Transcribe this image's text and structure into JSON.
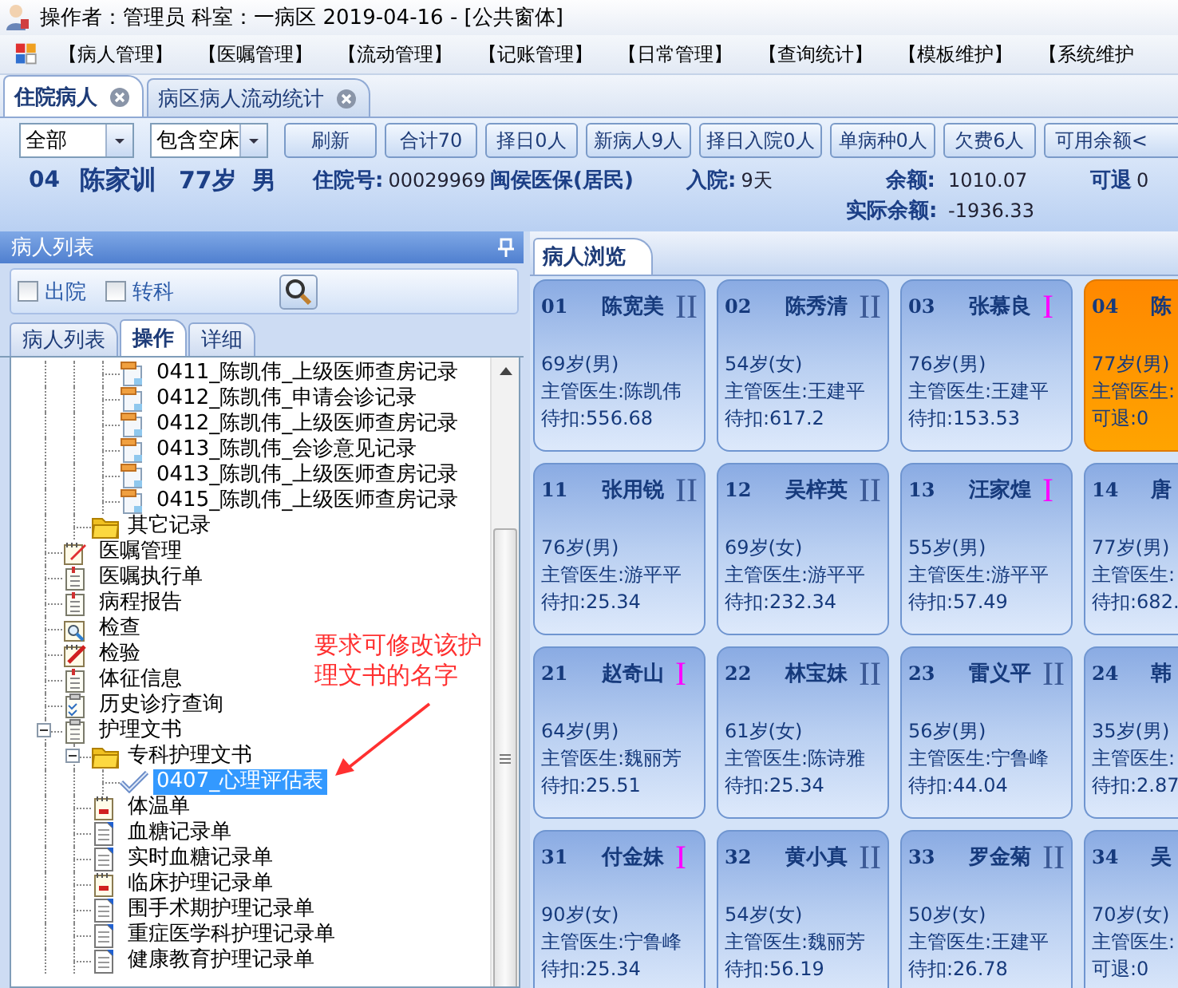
{
  "title_bar": {
    "text": "操作者：管理员 科室：一病区 2019-04-16 - [公共窗体]"
  },
  "menu": [
    "【病人管理】",
    "【医嘱管理】",
    "【流动管理】",
    "【记账管理】",
    "【日常管理】",
    "【查询统计】",
    "【模板维护】",
    "【系统维护"
  ],
  "doc_tabs": [
    {
      "label": "住院病人",
      "selected": true
    },
    {
      "label": "病区病人流动统计",
      "selected": false
    }
  ],
  "toolbar": {
    "selects": [
      "全部",
      "包含空床"
    ],
    "buttons": [
      "刷新",
      "合计70",
      "择日0人",
      "新病人9人",
      "择日入院0人",
      "单病种0人",
      "欠费6人",
      "可用余额<"
    ]
  },
  "patient_info": {
    "bed": "04",
    "name": "陈家训",
    "age": "77岁",
    "sex": "男",
    "admission_no": {
      "label": "住院号:",
      "value": "00029969"
    },
    "insurance": "闽侯医保(居民)",
    "admitted": {
      "label": "入院:",
      "value": "9天"
    },
    "balance": {
      "label": "余额:",
      "value": "1010.07"
    },
    "refundable": {
      "label": "可退",
      "value": "0"
    },
    "actual_balance": {
      "label": "实际余额:",
      "value": "-1936.33"
    }
  },
  "sidebar": {
    "title": "病人列表",
    "filters": [
      {
        "label": "出院",
        "checked": false
      },
      {
        "label": "转科",
        "checked": false
      }
    ],
    "tabs": [
      {
        "label": "病人列表",
        "selected": false
      },
      {
        "label": "操作",
        "selected": true
      },
      {
        "label": "详细",
        "selected": false
      }
    ],
    "tree": [
      {
        "children": [
          {
            "children": [
              {
                "kind": "record",
                "label": "0411_陈凯伟_上级医师查房记录",
                "selected": false
              },
              {
                "kind": "record",
                "label": "0412_陈凯伟_申请会诊记录",
                "selected": false
              },
              {
                "kind": "record",
                "label": "0412_陈凯伟_上级医师查房记录",
                "selected": false
              },
              {
                "kind": "record",
                "label": "0413_陈凯伟_会诊意见记录",
                "selected": false
              },
              {
                "kind": "record",
                "label": "0413_陈凯伟_上级医师查房记录",
                "selected": false
              },
              {
                "kind": "record",
                "label": "0415_陈凯伟_上级医师查房记录",
                "selected": false
              }
            ]
          },
          {
            "kind": "folder",
            "label": "其它记录",
            "selected": false
          }
        ]
      },
      {
        "kind": "order",
        "label": "医嘱管理",
        "selected": false
      },
      {
        "kind": "sheet",
        "label": "医嘱执行单",
        "selected": false
      },
      {
        "kind": "sheet",
        "label": "病程报告",
        "selected": false
      },
      {
        "kind": "exam",
        "label": "检查",
        "selected": false
      },
      {
        "kind": "lab",
        "label": "检验",
        "selected": false
      },
      {
        "kind": "sheet",
        "label": "体征信息",
        "selected": false
      },
      {
        "kind": "checklist",
        "label": "历史诊疗查询",
        "selected": false
      },
      {
        "kind": "clipboard",
        "label": "护理文书",
        "selected": false,
        "expanded": true,
        "children": [
          {
            "kind": "folder",
            "label": "专科护理文书",
            "selected": false,
            "expanded": true,
            "children": [
              {
                "kind": "check",
                "label": "0407_心理评估表",
                "selected": true
              }
            ]
          },
          {
            "kind": "chart",
            "label": "体温单",
            "selected": false
          },
          {
            "kind": "page",
            "label": "血糖记录单",
            "selected": false
          },
          {
            "kind": "page",
            "label": "实时血糖记录单",
            "selected": false
          },
          {
            "kind": "chart",
            "label": "临床护理记录单",
            "selected": false
          },
          {
            "kind": "page",
            "label": "围手术期护理记录单",
            "selected": false
          },
          {
            "kind": "page",
            "label": "重症医学科护理记录单",
            "selected": false
          },
          {
            "kind": "page",
            "label": "健康教育护理记录单",
            "selected": false
          }
        ]
      }
    ],
    "annotation": "要求可修改该护理文书的名字"
  },
  "browser": {
    "tab": "病人浏览",
    "patients": [
      {
        "bed": "01",
        "name": "陈宽美",
        "grade": "II",
        "color": "#3c5a96",
        "age": "69岁(男)",
        "doctor": "主管医生:陈凯伟",
        "balance": "待扣:556.68",
        "selected": false
      },
      {
        "bed": "02",
        "name": "陈秀清",
        "grade": "II",
        "color": "#3c5a96",
        "age": "54岁(女)",
        "doctor": "主管医生:王建平",
        "balance": "待扣:617.2",
        "selected": false
      },
      {
        "bed": "03",
        "name": "张慕良",
        "grade": "I",
        "color": "#ff00ff",
        "age": "76岁(男)",
        "doctor": "主管医生:王建平",
        "balance": "待扣:153.53",
        "selected": false
      },
      {
        "bed": "04",
        "name": "陈",
        "age": "77岁(男)",
        "doctor": "主管医生:",
        "balance": "可退:0",
        "selected": true
      },
      {
        "bed": "11",
        "name": "张用锐",
        "grade": "II",
        "color": "#3c5a96",
        "age": "76岁(男)",
        "doctor": "主管医生:游平平",
        "balance": "待扣:25.34",
        "selected": false
      },
      {
        "bed": "12",
        "name": "吴梓英",
        "grade": "II",
        "color": "#3c5a96",
        "age": "69岁(女)",
        "doctor": "主管医生:游平平",
        "balance": "待扣:232.34",
        "selected": false
      },
      {
        "bed": "13",
        "name": "汪家煌",
        "grade": "I",
        "color": "#ff00ff",
        "age": "55岁(男)",
        "doctor": "主管医生:游平平",
        "balance": "待扣:57.49",
        "selected": false
      },
      {
        "bed": "14",
        "name": "唐",
        "age": "77岁(男)",
        "doctor": "主管医生:",
        "balance": "待扣:682.",
        "selected": false
      },
      {
        "bed": "21",
        "name": "赵奇山",
        "grade": "I",
        "color": "#ff00ff",
        "age": "64岁(男)",
        "doctor": "主管医生:魏丽芳",
        "balance": "待扣:25.51",
        "selected": false
      },
      {
        "bed": "22",
        "name": "林宝妹",
        "grade": "II",
        "color": "#3c5a96",
        "age": "61岁(女)",
        "doctor": "主管医生:陈诗雅",
        "balance": "待扣:25.34",
        "selected": false
      },
      {
        "bed": "23",
        "name": "雷义平",
        "grade": "II",
        "color": "#3c5a96",
        "age": "56岁(男)",
        "doctor": "主管医生:宁鲁峰",
        "balance": "待扣:44.04",
        "selected": false
      },
      {
        "bed": "24",
        "name": "韩",
        "age": "35岁(男)",
        "doctor": "主管医生:",
        "balance": "待扣:2.87",
        "selected": false
      },
      {
        "bed": "31",
        "name": "付金妹",
        "grade": "I",
        "color": "#ff00ff",
        "age": "90岁(女)",
        "doctor": "主管医生:宁鲁峰",
        "balance": "待扣:25.34",
        "selected": false
      },
      {
        "bed": "32",
        "name": "黄小真",
        "grade": "II",
        "color": "#3c5a96",
        "age": "54岁(女)",
        "doctor": "主管医生:魏丽芳",
        "balance": "待扣:56.19",
        "selected": false
      },
      {
        "bed": "33",
        "name": "罗金菊",
        "grade": "II",
        "color": "#3c5a96",
        "age": "50岁(女)",
        "doctor": "主管医生:王建平",
        "balance": "待扣:26.78",
        "selected": false
      },
      {
        "bed": "34",
        "name": "吴",
        "age": "70岁(女)",
        "doctor": "主管医生:",
        "balance": "可退:0",
        "selected": false
      }
    ]
  }
}
